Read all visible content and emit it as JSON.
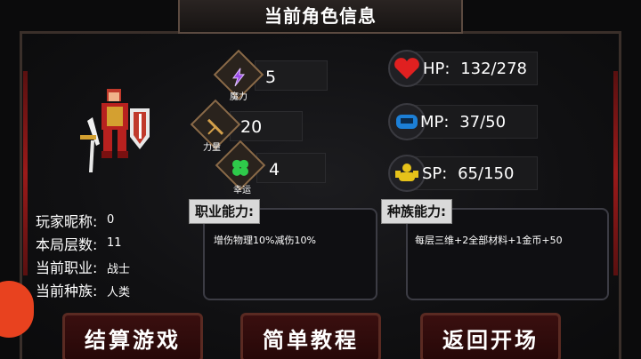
{
  "title": "当前角色信息",
  "stats": [
    {
      "icon": "magic-icon",
      "value": "5",
      "label": "魔力",
      "color": "#8a3ad6"
    },
    {
      "icon": "power-icon",
      "value": "20",
      "label": "力量",
      "color": "#d4a04a"
    },
    {
      "icon": "luck-icon",
      "value": "4",
      "label": "幸运",
      "color": "#2ec94a"
    }
  ],
  "resources": {
    "hp": {
      "label": "HP:",
      "value": "132/278",
      "color": "#e02020"
    },
    "mp": {
      "label": "MP:",
      "value": "37/50",
      "color": "#1c7fd6"
    },
    "sp": {
      "label": "SP:",
      "value": "65/150",
      "color": "#e6c21a"
    }
  },
  "player": {
    "nickname_label": "玩家昵称:",
    "nickname": "0",
    "floor_label": "本局层数:",
    "floor": "11",
    "job_label": "当前职业:",
    "job": "战士",
    "race_label": "当前种族:",
    "race": "人类"
  },
  "job_ability": {
    "title": "职业能力:",
    "text": "增伤物理10%减伤10%"
  },
  "race_ability": {
    "title": "种族能力:",
    "text": "每层三维+2全部材料+1金币+50"
  },
  "buttons": {
    "settle": "结算游戏",
    "tutorial": "简单教程",
    "return": "返回开场"
  },
  "colors": {
    "frame": "#4a3a32",
    "button": "#3a0f0f",
    "side_indicator": "#e8421f"
  }
}
